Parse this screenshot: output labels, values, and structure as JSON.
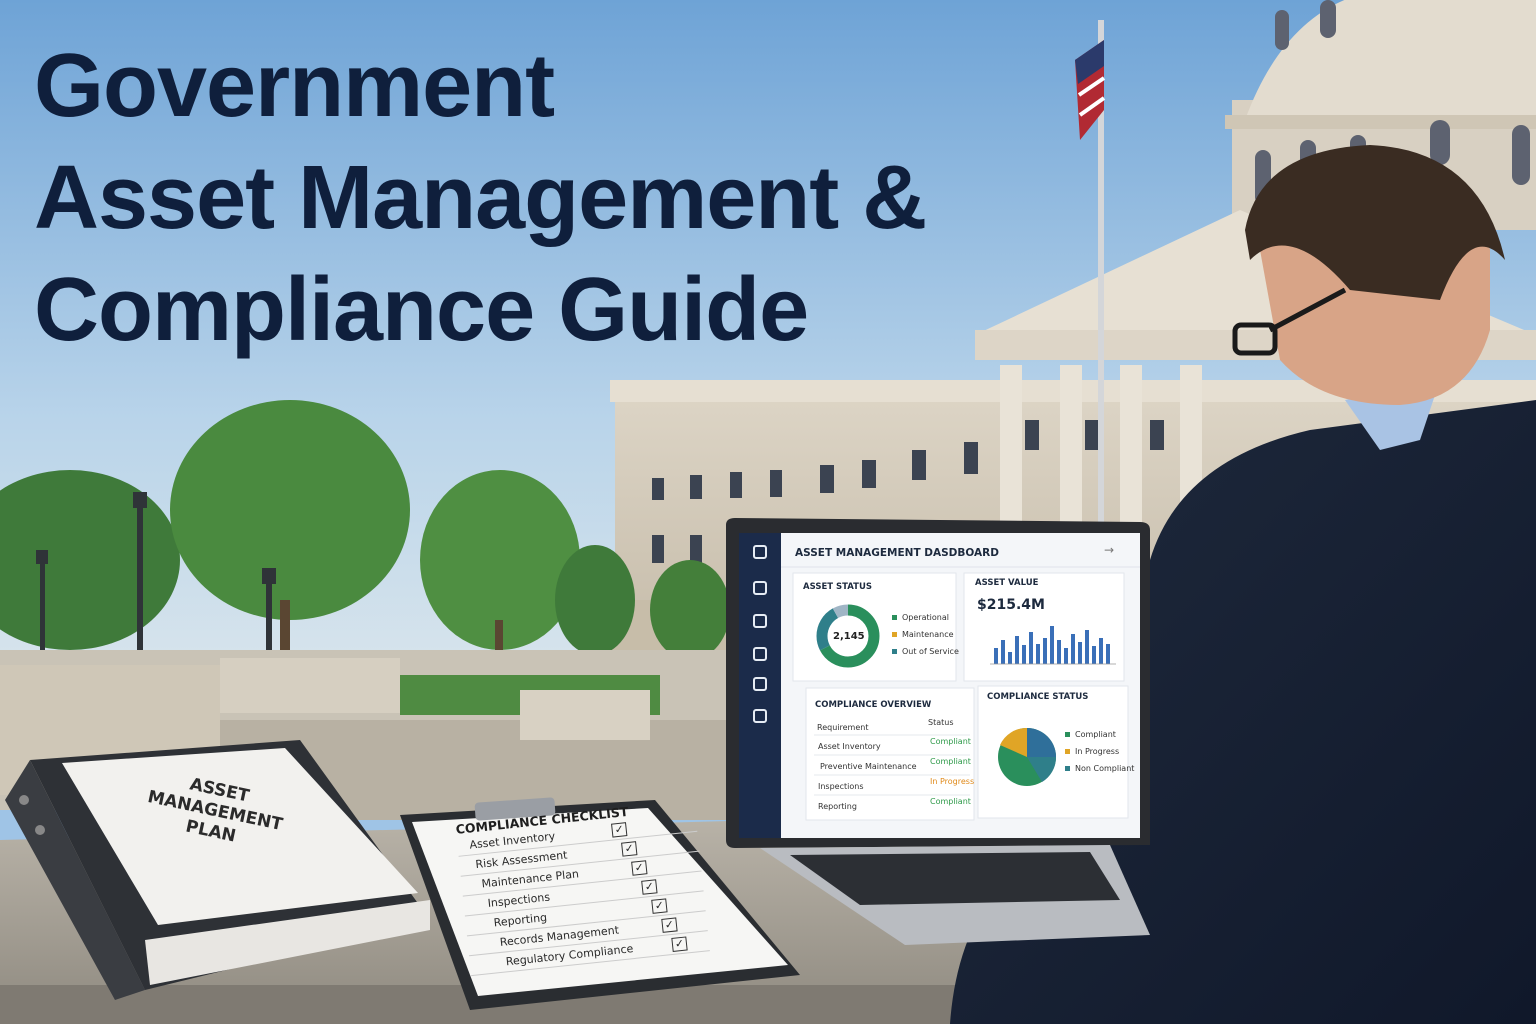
{
  "headline": {
    "line1": "Government",
    "line2": "Asset Management &",
    "line3": "Compliance Guide"
  },
  "binder": {
    "line1": "ASSET",
    "line2": "MANAGEMENT",
    "line3": "PLAN"
  },
  "checklist": {
    "title": "COMPLIANCE CHECKLIST",
    "items": [
      "Asset Inventory",
      "Risk Assessment",
      "Maintenance Plan",
      "Inspections",
      "Reporting",
      "Records Management",
      "Regulatory Compliance"
    ],
    "check_glyph": "✓"
  },
  "dashboard": {
    "title": "ASSET MANAGEMENT DASDBOARD",
    "asset_status": {
      "title": "ASSET STATUS",
      "total": "2,145",
      "legend": [
        "Operational",
        "Maintenance",
        "Out of Service"
      ]
    },
    "asset_value": {
      "title": "ASSET VALUE",
      "value": "$215.4M"
    },
    "compliance_overview": {
      "title": "COMPLIANCE OVERVIEW",
      "col1": "Requirement",
      "col2": "Status",
      "rows": [
        {
          "req": "Asset Inventory",
          "status": "Compliant"
        },
        {
          "req": "Preventive Maintenance",
          "status": "Compliant"
        },
        {
          "req": "Inspections",
          "status": "In Progress"
        },
        {
          "req": "Reporting",
          "status": "Compliant"
        }
      ]
    },
    "compliance_status": {
      "title": "COMPLIANCE STATUS",
      "legend": [
        "Compliant",
        "In Progress",
        "Non Compliant"
      ]
    }
  },
  "colors": {
    "headline": "#0f1f3c",
    "sidebar": "#1b2b4a",
    "operational": "#2a8f5c",
    "maintenance": "#e0a526",
    "out_of_service": "#2f7f8a",
    "bar": "#3a6fb8",
    "compliant": "#2f9a4a",
    "in_progress": "#e08a1a"
  }
}
